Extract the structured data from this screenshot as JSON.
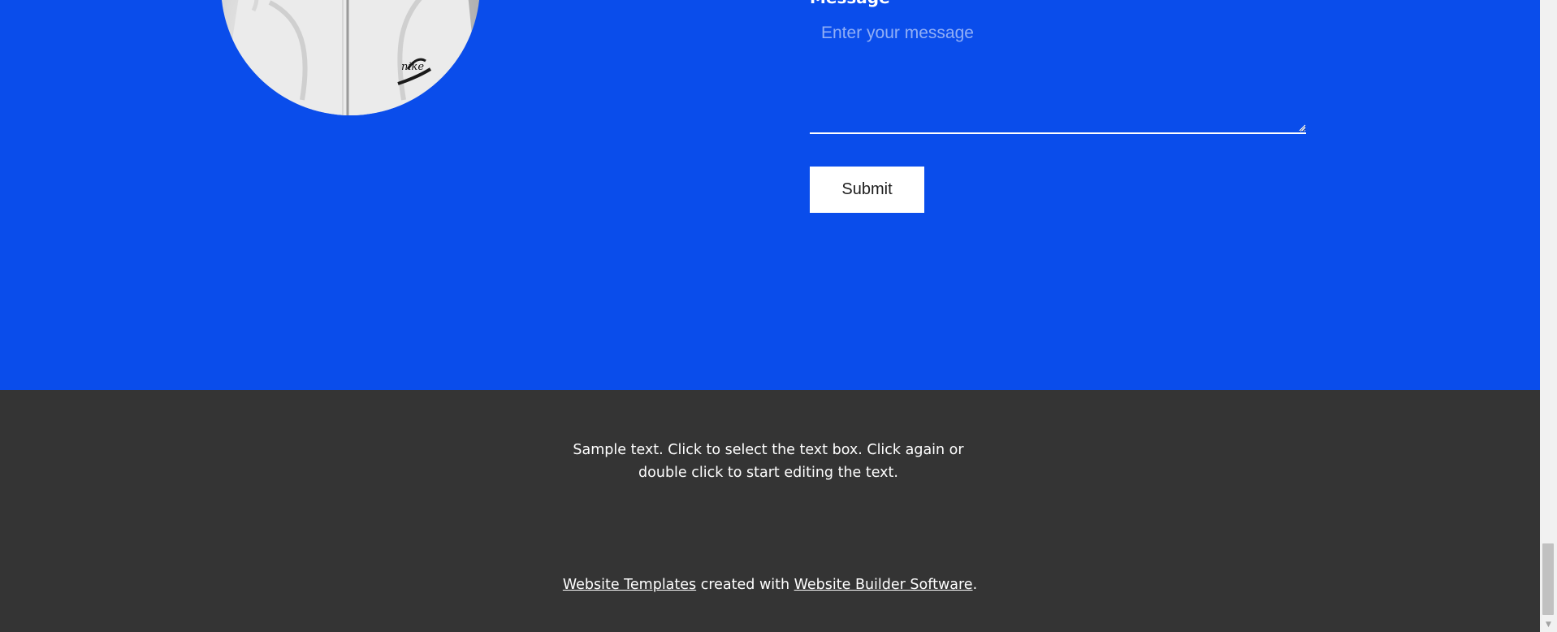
{
  "contact_form": {
    "message_label": "Message",
    "message_placeholder": "Enter your message",
    "message_value": "",
    "submit_label": "Submit"
  },
  "avatar": {
    "logo_text": "nike"
  },
  "footer": {
    "sample_text": "Sample text. Click to select the text box. Click again or double click to start editing the text.",
    "credit": {
      "link1": "Website Templates",
      "middle": " created with ",
      "link2": "Website Builder Software",
      "end": "."
    }
  },
  "scrollbar": {
    "down_arrow": "▼"
  },
  "colors": {
    "section_background": "#0a4deb",
    "footer_background": "#343434",
    "button_background": "#ffffff"
  }
}
